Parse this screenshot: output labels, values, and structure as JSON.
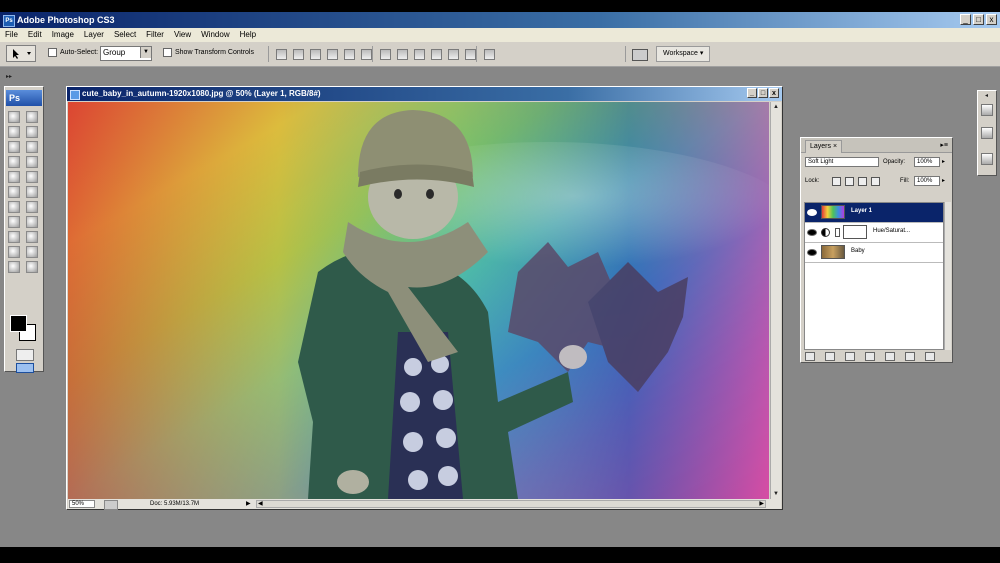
{
  "app": {
    "title": "Adobe Photoshop CS3",
    "logo": "Ps",
    "window_buttons": [
      "_",
      "□",
      "x"
    ]
  },
  "menu": [
    "File",
    "Edit",
    "Image",
    "Layer",
    "Select",
    "Filter",
    "View",
    "Window",
    "Help"
  ],
  "options": {
    "auto_select_label": "Auto-Select:",
    "auto_select_value": "Group",
    "transform_label": "Show Transform Controls",
    "workspace_label": "Workspace ▾"
  },
  "document": {
    "title": "cute_baby_in_autumn-1920x1080.jpg @ 50% (Layer 1, RGB/8#)",
    "zoom": "50%",
    "doc_size": "Doc: 5.93M/13.7M",
    "status_arrow": "▶",
    "scroll_up": "▲",
    "scroll_down": "▼",
    "scroll_left": "◀",
    "scroll_right": "▶"
  },
  "layers_panel": {
    "tab": "Layers ×",
    "menu": "▸≡",
    "blend_mode": "Soft Light",
    "opacity_label": "Opacity:",
    "opacity_value": "100%",
    "lock_label": "Lock:",
    "fill_label": "Fill:",
    "fill_value": "100%",
    "layers": [
      {
        "name": "Layer 1",
        "selected": true
      },
      {
        "name": "Hue/Saturat...",
        "selected": false
      },
      {
        "name": "Baby",
        "selected": false
      }
    ]
  },
  "colors": {
    "title_bar": "#0a246a",
    "workspace_bg": "#878787",
    "panel_bg": "#d4d0c8",
    "selection": "#0a246a"
  },
  "icons": {
    "tools": [
      "marquee-icon",
      "move-icon",
      "lasso-icon",
      "magic-wand-icon",
      "crop-icon",
      "slice-icon",
      "healing-brush-icon",
      "brush-icon",
      "clone-stamp-icon",
      "history-brush-icon",
      "eraser-icon",
      "gradient-icon",
      "blur-icon",
      "dodge-icon",
      "pen-icon",
      "type-icon",
      "path-selection-icon",
      "shape-icon",
      "notes-icon",
      "eyedropper-icon",
      "hand-icon",
      "zoom-icon"
    ]
  }
}
